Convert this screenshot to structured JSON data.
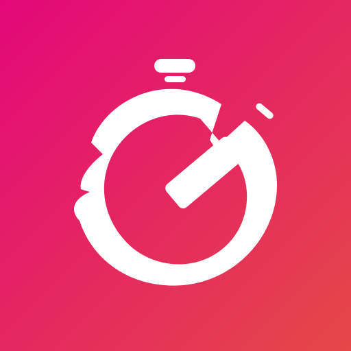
{
  "app_icon": {
    "icon_name": "stopwatch-icon",
    "colors": {
      "gradient_start": "#e3087a",
      "gradient_mid": "#e52a5e",
      "gradient_end": "#e54848",
      "glyph": "#ffffff"
    }
  }
}
